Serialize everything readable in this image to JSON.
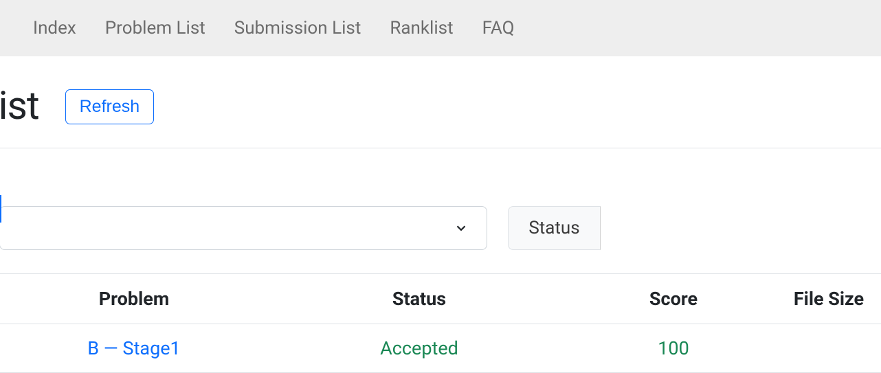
{
  "nav": {
    "items": [
      {
        "label": "Index"
      },
      {
        "label": "Problem List"
      },
      {
        "label": "Submission List"
      },
      {
        "label": "Ranklist"
      },
      {
        "label": "FAQ"
      }
    ]
  },
  "header": {
    "title_fragment": "ion List",
    "refresh_label": "Refresh"
  },
  "filters": {
    "status_label": "Status"
  },
  "table": {
    "headers": {
      "problem": "Problem",
      "status": "Status",
      "score": "Score",
      "filesize": "File Size"
    },
    "rows": [
      {
        "problem": "B — Stage1",
        "status": "Accepted",
        "score": "100",
        "filesize": ""
      }
    ]
  }
}
